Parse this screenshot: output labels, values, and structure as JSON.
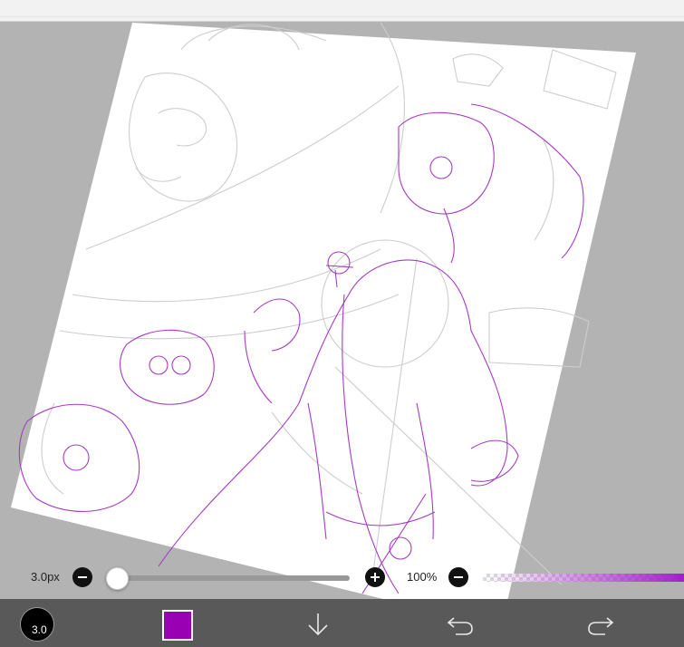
{
  "brush": {
    "size_label": "3.0px",
    "size_value": 3.0,
    "size_fraction": 0.0,
    "button_label": "3.0"
  },
  "zoom": {
    "label": "100%"
  },
  "color": {
    "current": "#9900b3",
    "line_primary": "#a43cc4",
    "line_secondary": "#c9c9c9",
    "canvas_background": "#b3b3b3",
    "toolbar_background": "#595959"
  },
  "toolbar": {
    "icons": [
      "brush-size-icon",
      "color-swatch",
      "arrow-down-icon",
      "undo-icon",
      "redo-icon"
    ]
  }
}
